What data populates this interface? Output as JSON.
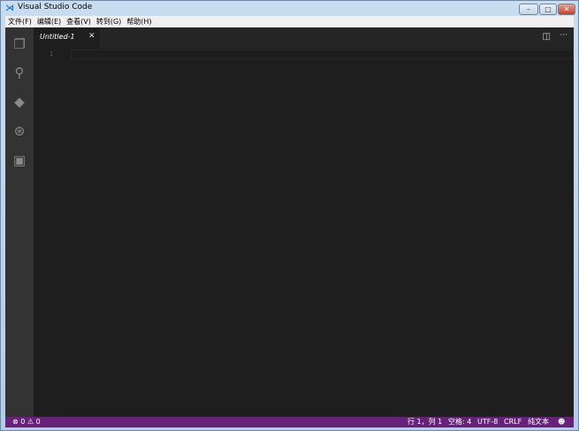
{
  "window": {
    "title": "Visual Studio Code",
    "minimize": "–",
    "maximize": "□",
    "close": "✕"
  },
  "menu": [
    "文件(F)",
    "编辑(E)",
    "查看(V)",
    "转到(G)",
    "帮助(H)"
  ],
  "tab": {
    "label": "Untitled-1",
    "close": "✕"
  },
  "editor": {
    "line_numbers": [
      "1"
    ]
  },
  "status": {
    "errors": "0",
    "warnings": "0",
    "position": "行 1，列 1",
    "indent": "空格: 4",
    "encoding": "UTF-8",
    "eol": "CRLF",
    "language": "纯文本"
  },
  "colors": {
    "statusbar": "#68217a",
    "activitybar": "#333333",
    "editor": "#1e1e1e"
  }
}
